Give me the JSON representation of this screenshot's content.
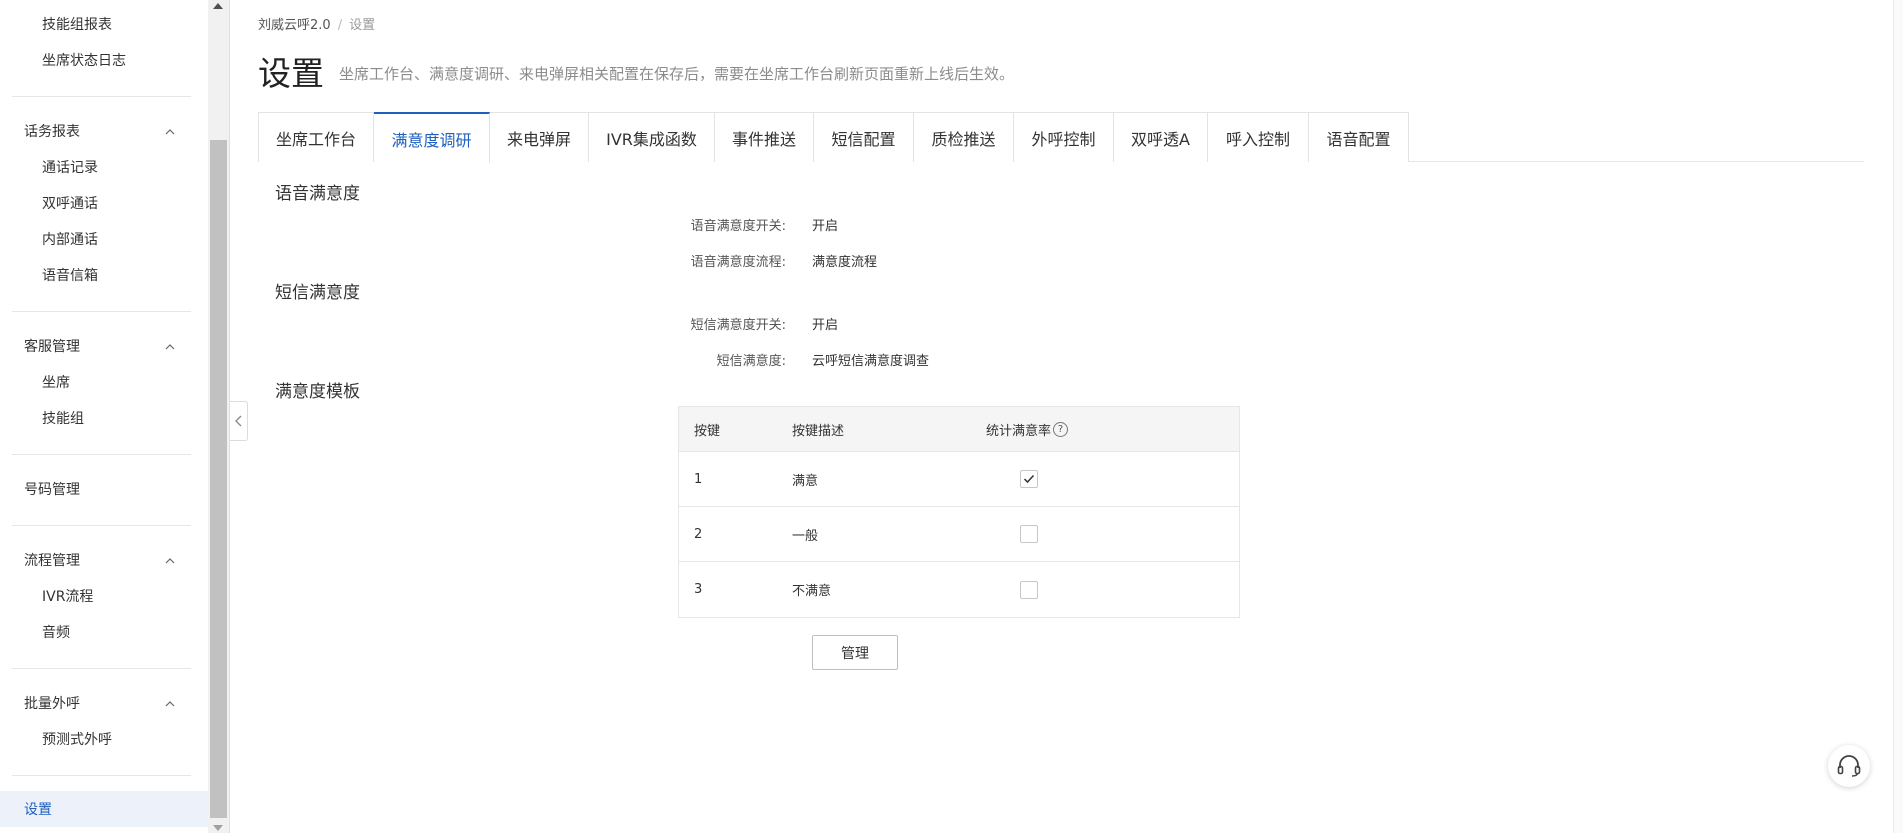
{
  "sidebar": {
    "top_items": [
      "技能组报表",
      "坐席状态日志"
    ],
    "groups": [
      {
        "label": "话务报表",
        "items": [
          "通话记录",
          "双呼通话",
          "内部通话",
          "语音信箱"
        ]
      },
      {
        "label": "客服管理",
        "items": [
          "坐席",
          "技能组"
        ]
      },
      {
        "label": "号码管理",
        "items": []
      },
      {
        "label": "流程管理",
        "items": [
          "IVR流程",
          "音频"
        ]
      },
      {
        "label": "批量外呼",
        "items": [
          "预测式外呼"
        ]
      }
    ],
    "active_item": "设置"
  },
  "breadcrumb": {
    "root": "刘威云呼2.0",
    "separator": "/",
    "current": "设置"
  },
  "header": {
    "title": "设置",
    "description": "坐席工作台、满意度调研、来电弹屏相关配置在保存后，需要在坐席工作台刷新页面重新上线后生效。"
  },
  "tabs": [
    "坐席工作台",
    "满意度调研",
    "来电弹屏",
    "IVR集成函数",
    "事件推送",
    "短信配置",
    "质检推送",
    "外呼控制",
    "双呼透A",
    "呼入控制",
    "语音配置"
  ],
  "active_tab": "满意度调研",
  "voice_satisfaction": {
    "title": "语音满意度",
    "switch_label": "语音满意度开关:",
    "switch_value": "开启",
    "flow_label": "语音满意度流程:",
    "flow_value": "满意度流程"
  },
  "sms_satisfaction": {
    "title": "短信满意度",
    "switch_label": "短信满意度开关:",
    "switch_value": "开启",
    "sms_label": "短信满意度:",
    "sms_value": "云呼短信满意度调查"
  },
  "template": {
    "title": "满意度模板",
    "columns": [
      "按键",
      "按键描述",
      "统计满意率"
    ],
    "help_icon": "?",
    "rows": [
      {
        "key": "1",
        "desc": "满意",
        "checked": true
      },
      {
        "key": "2",
        "desc": "一般",
        "checked": false
      },
      {
        "key": "3",
        "desc": "不满意",
        "checked": false
      }
    ],
    "manage_button": "管理"
  },
  "colors": {
    "accent": "#1f5fbf",
    "border": "#e6e6e6",
    "active_bg": "#edf2fa"
  }
}
